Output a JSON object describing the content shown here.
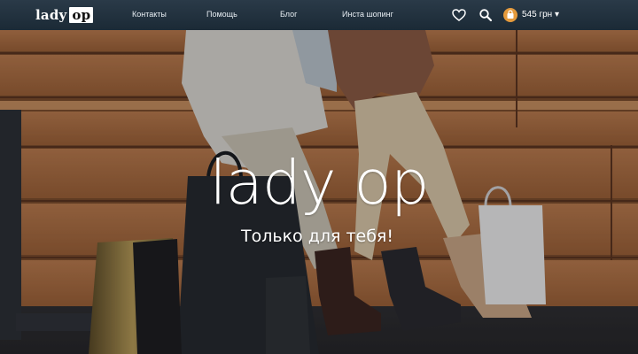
{
  "header": {
    "logo": {
      "text": "lady",
      "badge": "op"
    },
    "nav": [
      {
        "label": "Контакты"
      },
      {
        "label": "Помощь"
      },
      {
        "label": "Блог"
      },
      {
        "label": "Инста шопинг"
      }
    ],
    "icons": {
      "favorites": "heart-icon",
      "search": "search-icon",
      "cart": "bag-icon"
    },
    "cart_total": "545 грн ▾"
  },
  "hero": {
    "title": "lady op",
    "subtitle": "Только для тебя!"
  },
  "colors": {
    "header_bg": "#1f2f3c",
    "cart_badge": "#e49a3c",
    "text": "#ffffff"
  }
}
